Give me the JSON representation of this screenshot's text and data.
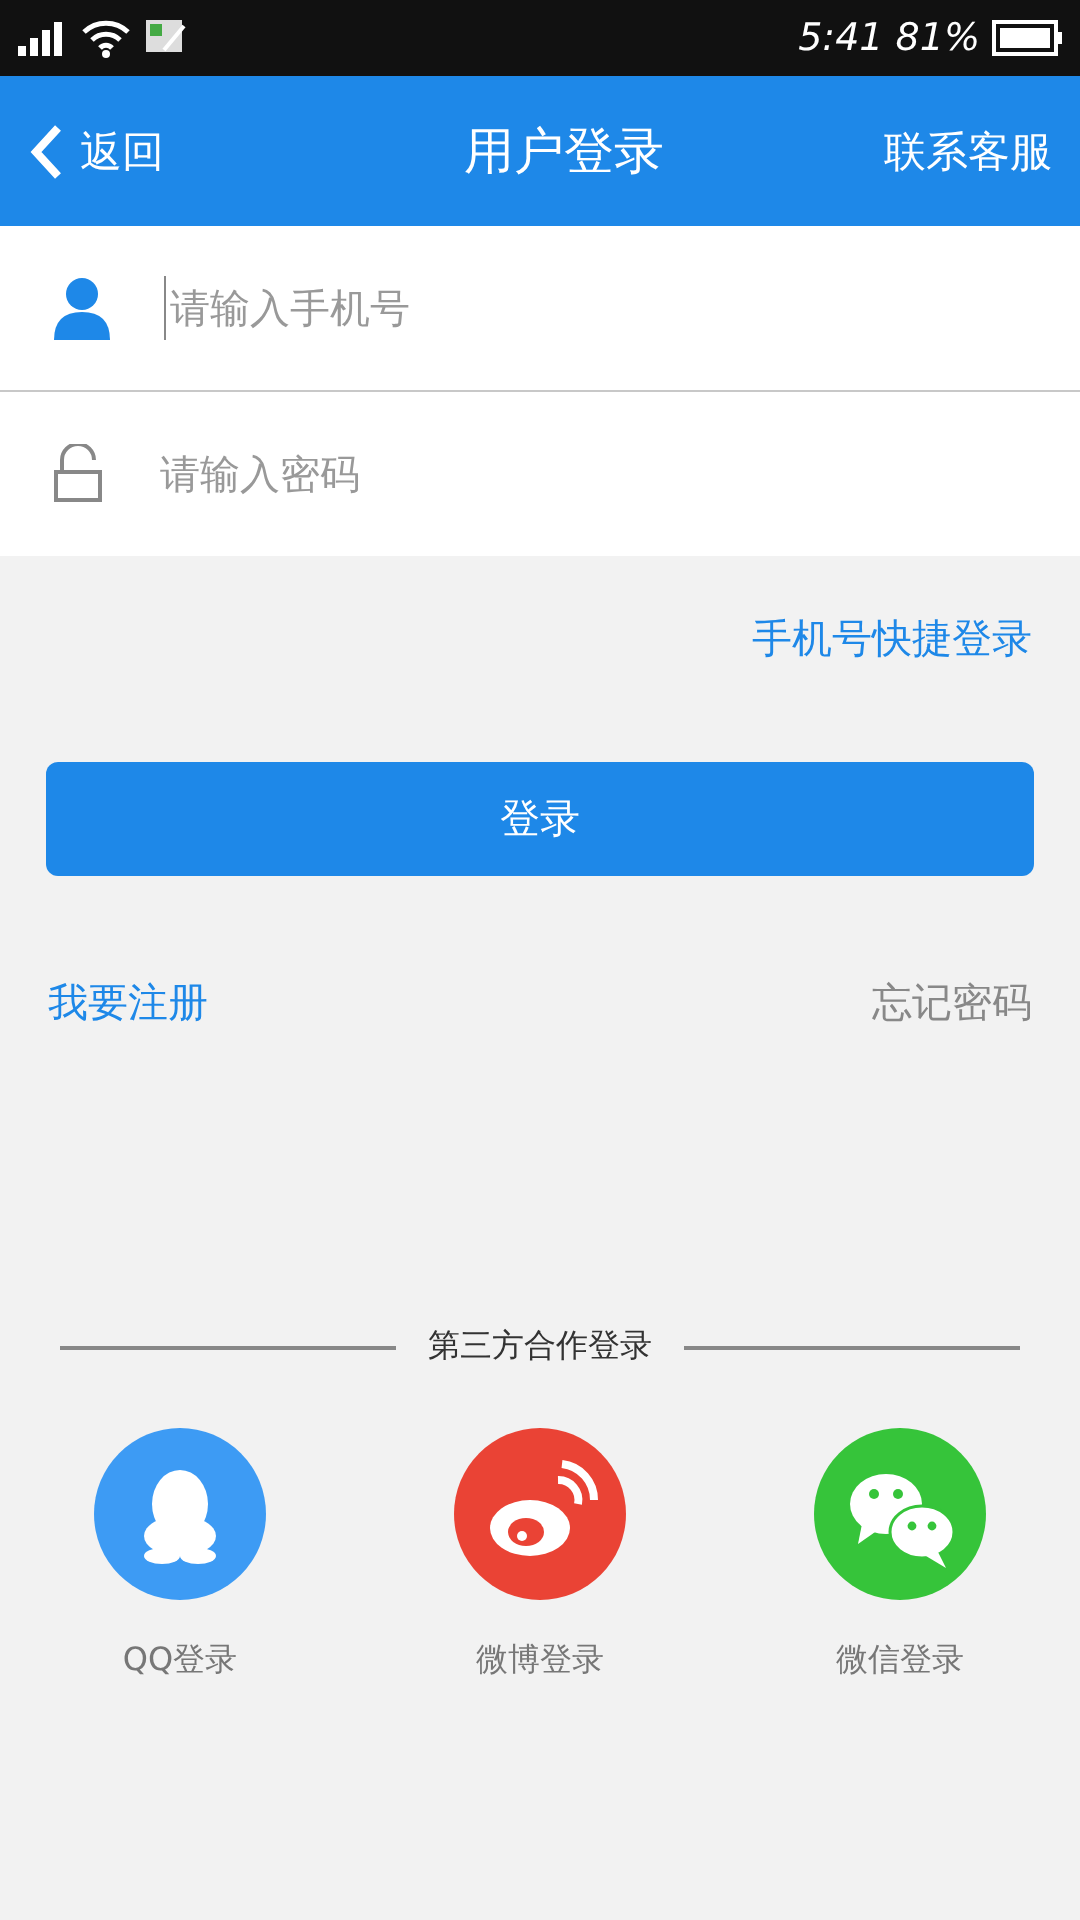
{
  "status_bar": {
    "time": "5:41",
    "battery": "81%"
  },
  "header": {
    "back": "返回",
    "title": "用户登录",
    "action": "联系客服"
  },
  "fields": [
    {
      "kind": "user",
      "placeholder": "请输入手机号"
    },
    {
      "kind": "lock",
      "placeholder": "请输入密码"
    }
  ],
  "quick_login": "手机号快捷登录",
  "login_button": "登录",
  "register": "我要注册",
  "forgot": "忘记密码",
  "third_party": {
    "heading": "第三方合作登录",
    "items": [
      {
        "kind": "qq",
        "label": "QQ登录",
        "color": "#3d9bf4"
      },
      {
        "kind": "weibo",
        "label": "微博登录",
        "color": "#ea4335"
      },
      {
        "kind": "wechat",
        "label": "微信登录",
        "color": "#36c43a"
      }
    ]
  }
}
